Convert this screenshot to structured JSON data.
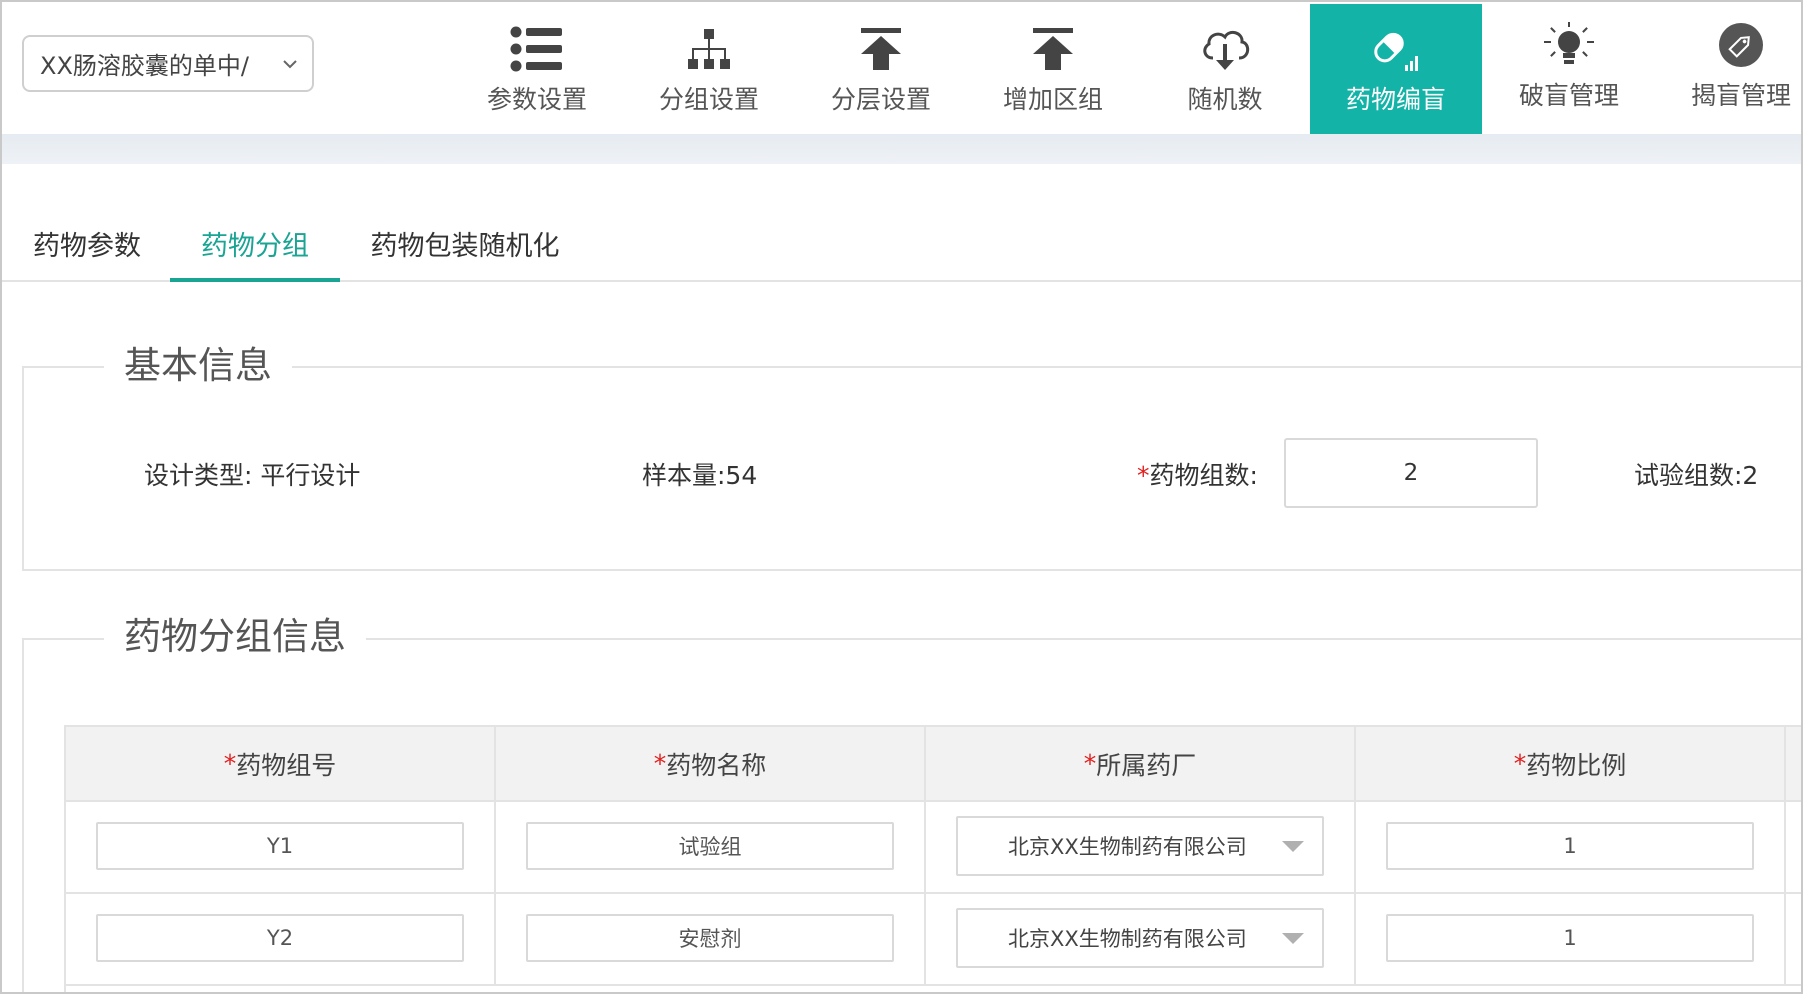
{
  "project_select": {
    "value": "XX肠溶胶囊的单中/"
  },
  "nav": [
    {
      "label": "参数设置",
      "icon": "list-icon",
      "active": false
    },
    {
      "label": "分组设置",
      "icon": "hierarchy-icon",
      "active": false
    },
    {
      "label": "分层设置",
      "icon": "upload-arrow-icon",
      "active": false
    },
    {
      "label": "增加区组",
      "icon": "upload-arrow-icon",
      "active": false
    },
    {
      "label": "随机数",
      "icon": "cloud-download-icon",
      "active": false
    },
    {
      "label": "药物编盲",
      "icon": "pill-icon",
      "active": true
    },
    {
      "label": "破盲管理",
      "icon": "lightbulb-icon",
      "active": false
    },
    {
      "label": "揭盲管理",
      "icon": "tag-icon",
      "active": false
    }
  ],
  "tabs": [
    {
      "label": "药物参数",
      "active": false
    },
    {
      "label": "药物分组",
      "active": true
    },
    {
      "label": "药物包装随机化",
      "active": false
    }
  ],
  "basic_info": {
    "legend": "基本信息",
    "design_type": "设计类型: 平行设计",
    "sample_size": "样本量:54",
    "drug_group_label": "药物组数:",
    "drug_group_value": "2",
    "trial_groups": "试验组数:2"
  },
  "group_info": {
    "legend": "药物分组信息",
    "required_mark": "*",
    "columns": [
      "药物组号",
      "药物名称",
      "所属药厂",
      "药物比例"
    ],
    "rows": [
      {
        "group_no": "Y1",
        "drug_name": "试验组",
        "factory": "北京XX生物制药有限公司",
        "ratio": "1"
      },
      {
        "group_no": "Y2",
        "drug_name": "安慰剂",
        "factory": "北京XX生物制药有限公司",
        "ratio": "1"
      }
    ]
  },
  "colors": {
    "accent": "#13b3a7",
    "tab_active": "#1aa493",
    "required": "#e02020"
  }
}
